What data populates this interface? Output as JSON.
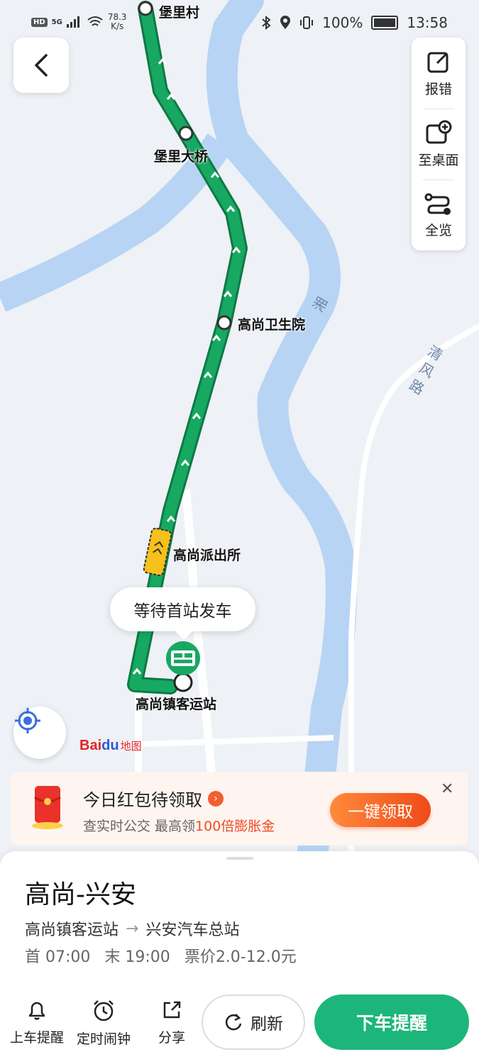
{
  "status_bar": {
    "hd": "HD",
    "network": "5G",
    "speed_value": "78.3",
    "speed_unit": "K/s",
    "battery": "100%",
    "time": "13:58"
  },
  "map": {
    "stops": [
      {
        "name": "堡里村"
      },
      {
        "name": "堡里大桥"
      },
      {
        "name": "高尚卫生院"
      },
      {
        "name": "高尚派出所"
      },
      {
        "name": "高尚镇客运站"
      }
    ],
    "river_label": "湘",
    "road_label_chars": [
      "清",
      "风",
      "路"
    ],
    "bus_status": "等待首站发车",
    "logo_bai": "Bai",
    "logo_du": "du",
    "logo_cn": "地图",
    "route_color": "#17a862",
    "river_color": "#b7d4f4"
  },
  "tools": [
    {
      "label": "报错",
      "icon": "edit-icon"
    },
    {
      "label": "至桌面",
      "icon": "add-to-desktop-icon"
    },
    {
      "label": "全览",
      "icon": "route-overview-icon"
    }
  ],
  "promo": {
    "title": "今日红包待领取",
    "sub_prefix": "查实时公交 最高领",
    "sub_highlight": "100倍膨胀金",
    "button": "一键领取",
    "close": "✕"
  },
  "route": {
    "name": "高尚-兴安",
    "from": "高尚镇客运站",
    "arrow": "→",
    "to": "兴安汽车总站",
    "first": "首 07:00",
    "last": "末 19:00",
    "fare": "票价2.0-12.0元"
  },
  "actions": {
    "board_reminder": "上车提醒",
    "timer_alarm": "定时闹钟",
    "share": "分享",
    "refresh": "刷新",
    "get_off_reminder": "下车提醒"
  }
}
